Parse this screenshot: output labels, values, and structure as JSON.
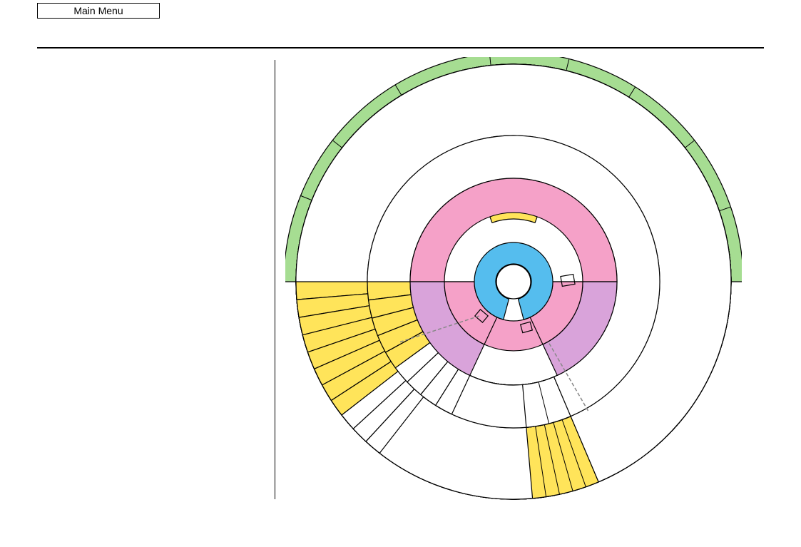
{
  "header": {
    "main_menu_label": "Main Menu"
  },
  "colors": {
    "hub_blue": "#55bdee",
    "ring_pink": "#f5a1c8",
    "ring_lilac": "#d9a3da",
    "sector_yellow": "#ffe45a",
    "arc_orange": "#f9aa4f",
    "arc_green": "#a6dd92",
    "sector_white": "#ffffff",
    "outline": "#000000",
    "dashed_line": "#888888"
  }
}
